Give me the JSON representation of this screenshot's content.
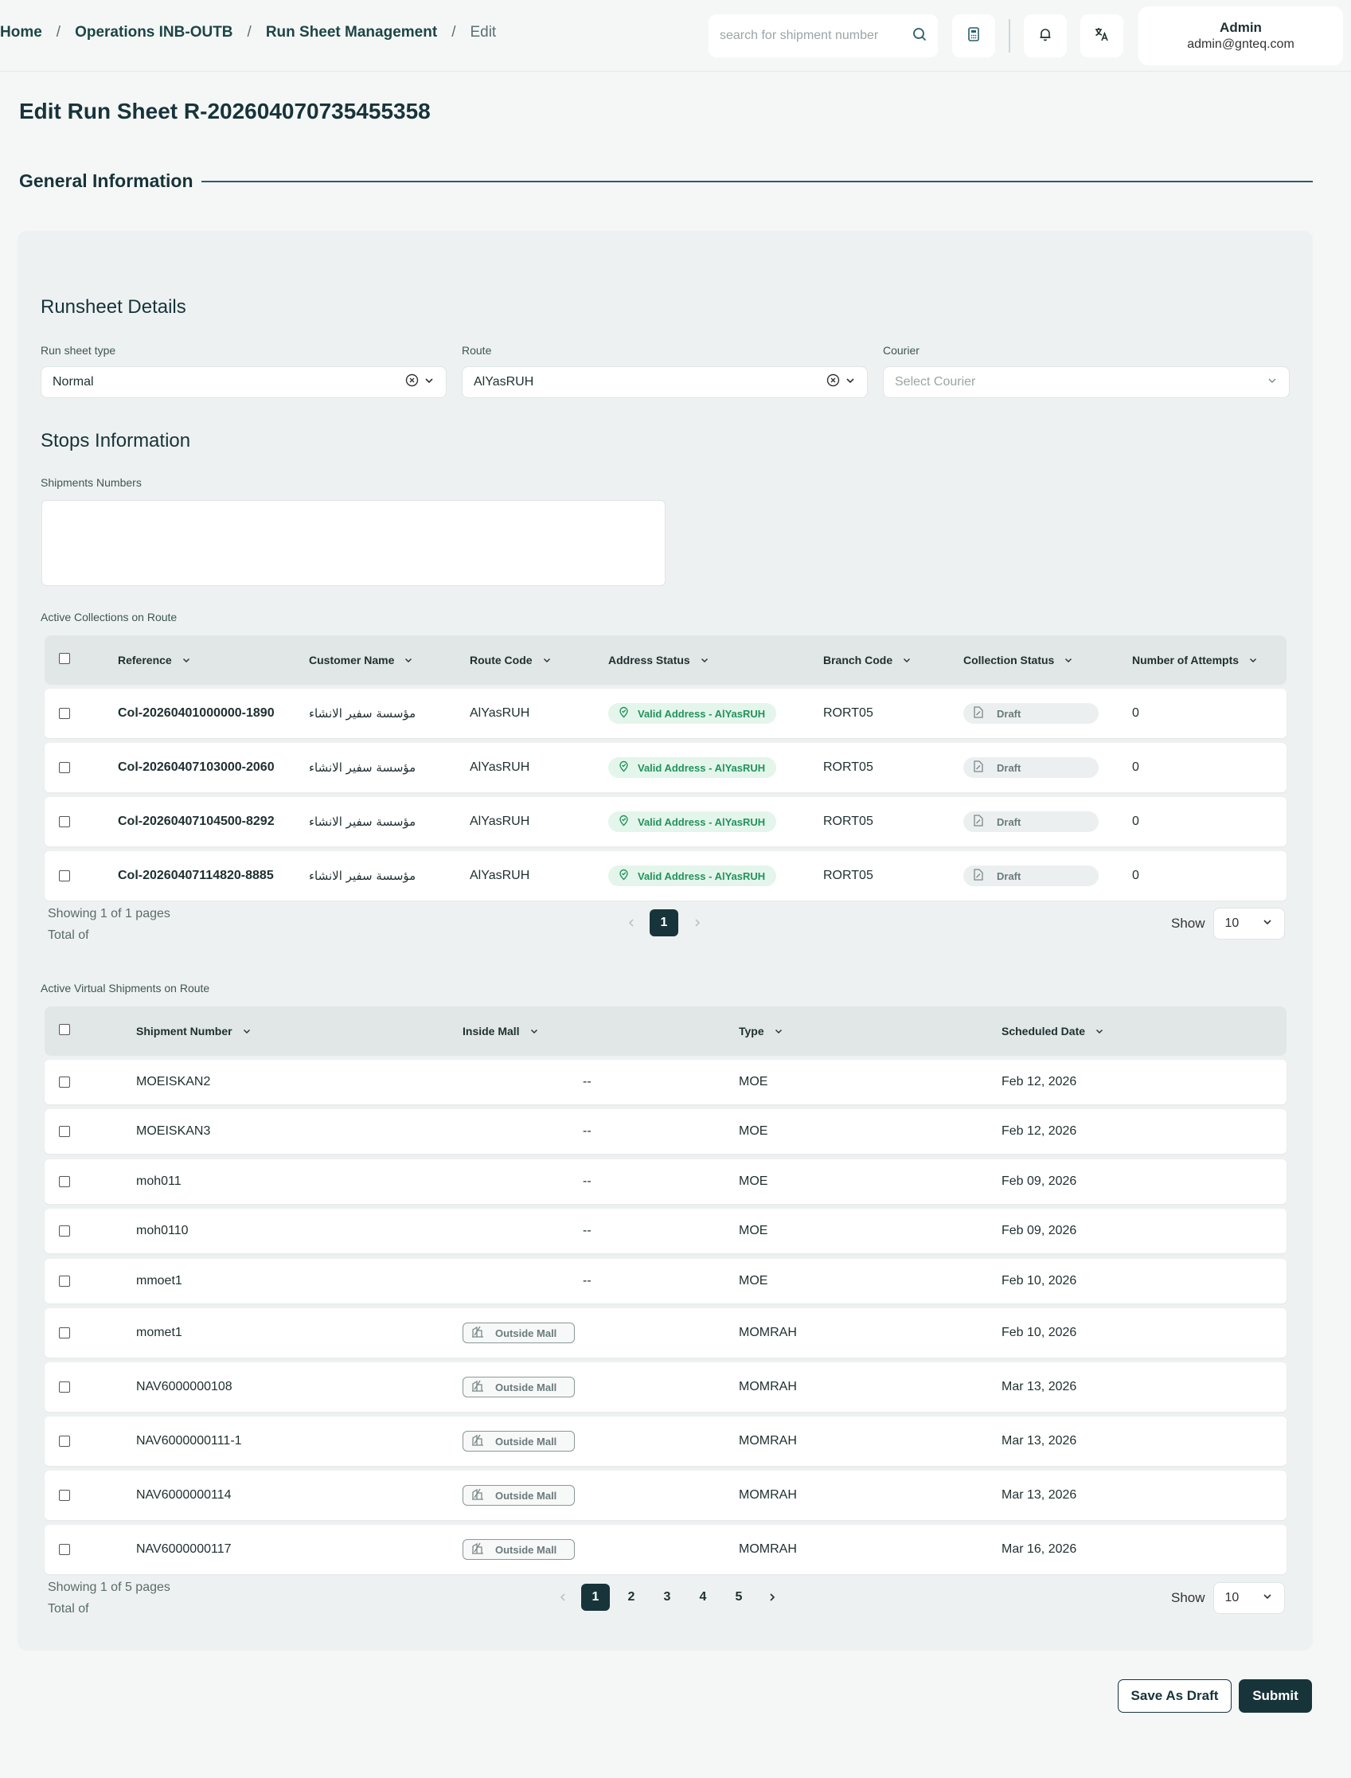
{
  "breadcrumb": {
    "home": "Home",
    "ops": "Operations INB-OUTB",
    "rsm": "Run Sheet Management",
    "current": "Edit",
    "sep": "/"
  },
  "search": {
    "placeholder": "search for shipment number"
  },
  "user": {
    "name": "Admin",
    "email": "admin@gnteq.com"
  },
  "page": {
    "title": "Edit Run Sheet R-20260407073545535​8"
  },
  "general": {
    "title": "General Information"
  },
  "runsheet": {
    "title": "Runsheet Details",
    "type_label": "Run sheet type",
    "type_value": "Normal",
    "route_label": "Route",
    "route_value": "AlYasRUH",
    "courier_label": "Courier",
    "courier_placeholder": "Select Courier"
  },
  "stops": {
    "title": "Stops Information",
    "shipments_label": "Shipments Numbers"
  },
  "collections": {
    "label": "Active Collections on Route",
    "headers": [
      "Reference",
      "Customer Name",
      "Route Code",
      "Address Status",
      "Branch Code",
      "Collection Status",
      "Number of Attempts"
    ],
    "rows": [
      {
        "ref": "Col-20260401000000-1890",
        "customer": "مؤسسة سفير الانشاء",
        "route": "AlYasRUH",
        "address": "Valid Address - AlYasRUH",
        "branch": "RORT05",
        "status": "Draft",
        "attempts": "0"
      },
      {
        "ref": "Col-20260407103000-2060",
        "customer": "مؤسسة سفير الانشاء",
        "route": "AlYasRUH",
        "address": "Valid Address - AlYasRUH",
        "branch": "RORT05",
        "status": "Draft",
        "attempts": "0"
      },
      {
        "ref": "Col-20260407104500-8292",
        "customer": "مؤسسة سفير الانشاء",
        "route": "AlYasRUH",
        "address": "Valid Address - AlYasRUH",
        "branch": "RORT05",
        "status": "Draft",
        "attempts": "0"
      },
      {
        "ref": "Col-20260407114820-8885",
        "customer": "مؤسسة سفير الانشاء",
        "route": "AlYasRUH",
        "address": "Valid Address - AlYasRUH",
        "branch": "RORT05",
        "status": "Draft",
        "attempts": "0"
      }
    ],
    "showing": "Showing 1 of 1 pages",
    "total": "Total of",
    "pages": [
      "1"
    ],
    "show_label": "Show",
    "show_value": "10"
  },
  "virtual": {
    "label": "Active Virtual Shipments on Route",
    "headers": [
      "Shipment Number",
      "Inside Mall",
      "Type",
      "Scheduled Date"
    ],
    "rows": [
      {
        "number": "MOEISKAN2",
        "mall": "--",
        "type": "MOE",
        "date": "Feb 12, 2026"
      },
      {
        "number": "MOEISKAN3",
        "mall": "--",
        "type": "MOE",
        "date": "Feb 12, 2026"
      },
      {
        "number": "moh011",
        "mall": "--",
        "type": "MOE",
        "date": "Feb 09, 2026"
      },
      {
        "number": "moh0110",
        "mall": "--",
        "type": "MOE",
        "date": "Feb 09, 2026"
      },
      {
        "number": "mmoet1",
        "mall": "--",
        "type": "MOE",
        "date": "Feb 10, 2026"
      },
      {
        "number": "momet1",
        "mall": "Outside Mall",
        "type": "MOMRAH",
        "date": "Feb 10, 2026"
      },
      {
        "number": "NAV6000000108",
        "mall": "Outside Mall",
        "type": "MOMRAH",
        "date": "Mar 13, 2026"
      },
      {
        "number": "NAV6000000111-1",
        "mall": "Outside Mall",
        "type": "MOMRAH",
        "date": "Mar 13, 2026"
      },
      {
        "number": "NAV6000000114",
        "mall": "Outside Mall",
        "type": "MOMRAH",
        "date": "Mar 13, 2026"
      },
      {
        "number": "NAV6000000117",
        "mall": "Outside Mall",
        "type": "MOMRAH",
        "date": "Mar 16, 2026"
      }
    ],
    "showing": "Showing 1 of 5 pages",
    "total": "Total of",
    "pages": [
      "1",
      "2",
      "3",
      "4",
      "5"
    ],
    "show_label": "Show",
    "show_value": "10"
  },
  "actions": {
    "draft": "Save As Draft",
    "submit": "Submit"
  },
  "colors": {
    "primary": "#17343a",
    "valid_bg": "#e4f5ec",
    "valid_fg": "#22935a",
    "draft_bg": "#eceff0"
  }
}
